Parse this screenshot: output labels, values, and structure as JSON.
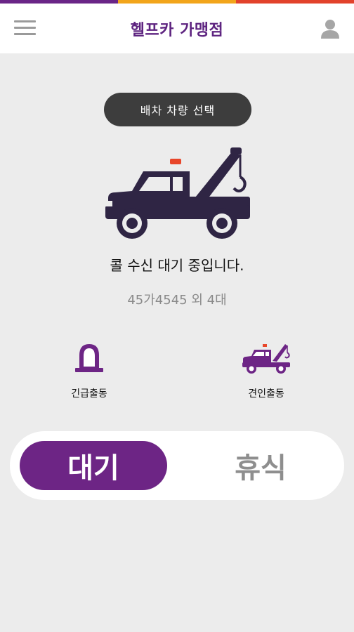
{
  "header": {
    "title": "헬프카 가맹점",
    "stripe_colors": [
      "#6a2587",
      "#f2a51b",
      "#e2422c"
    ]
  },
  "vehicle_select": {
    "label": "배차 차량 선택"
  },
  "status": {
    "message": "콜 수신 대기 중입니다.",
    "vehicle_info": "45가4545 외 4대"
  },
  "actions": [
    {
      "label": "긴급출동",
      "icon": "siren-icon"
    },
    {
      "label": "견인출동",
      "icon": "tow-truck-icon"
    }
  ],
  "mode_toggle": {
    "active_label": "대기",
    "inactive_label": "휴식"
  },
  "colors": {
    "accent": "#6d2585",
    "truck": "#2f2544",
    "beacon": "#e8462a"
  }
}
